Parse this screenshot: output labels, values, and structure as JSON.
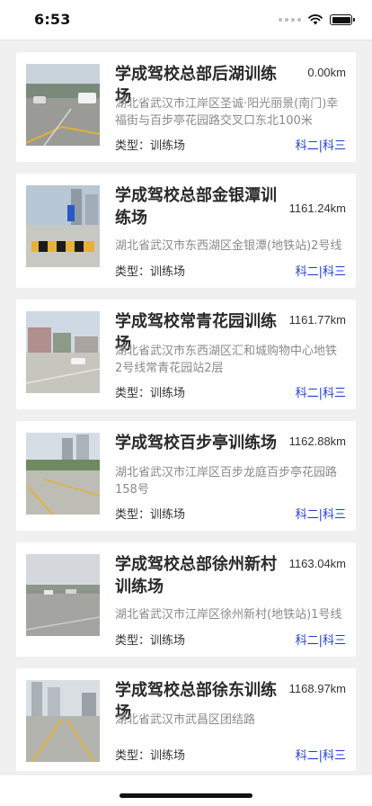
{
  "status_bar": {
    "time": "6:53",
    "icons": [
      "signal-dots-icon",
      "wifi-icon",
      "battery-icon"
    ]
  },
  "labels": {
    "type_prefix": "类型：",
    "subjects_separator": "|"
  },
  "colors": {
    "link": "#1f3ed0",
    "address": "#8a8a8a",
    "background": "#f0f0f0"
  },
  "sites": [
    {
      "name": "学成驾校总部后湖训练场",
      "distance": "0.00km",
      "address": "湖北省武汉市江岸区圣诚·阳光丽景(南门)幸福街与百步亭花园路交叉口东北100米",
      "type": "训练场",
      "subject_a": "科二",
      "subject_b": "科三",
      "photo": "training-ground-photo"
    },
    {
      "name": "学成驾校总部金银潭训练场",
      "distance": "1161.24km",
      "address": "湖北省武汉市东西湖区金银潭(地铁站)2号线",
      "type": "训练场",
      "subject_a": "科二",
      "subject_b": "科三",
      "photo": "training-ground-photo"
    },
    {
      "name": "学成驾校常青花园训练场",
      "distance": "1161.77km",
      "address": "湖北省武汉市东西湖区汇和城购物中心地铁2号线常青花园站2层",
      "type": "训练场",
      "subject_a": "科二",
      "subject_b": "科三",
      "photo": "training-ground-photo"
    },
    {
      "name": "学成驾校百步亭训练场",
      "distance": "1162.88km",
      "address": "湖北省武汉市江岸区百步龙庭百步亭花园路158号",
      "type": "训练场",
      "subject_a": "科二",
      "subject_b": "科三",
      "photo": "training-ground-photo"
    },
    {
      "name": "学成驾校总部徐州新村训练场",
      "distance": "1163.04km",
      "address": "湖北省武汉市江岸区徐州新村(地铁站)1号线",
      "type": "训练场",
      "subject_a": "科二",
      "subject_b": "科三",
      "photo": "training-ground-photo"
    },
    {
      "name": "学成驾校总部徐东训练场",
      "distance": "1168.97km",
      "address": "湖北省武汉市武昌区团结路",
      "type": "训练场",
      "subject_a": "科二",
      "subject_b": "科三",
      "photo": "training-ground-photo"
    }
  ]
}
